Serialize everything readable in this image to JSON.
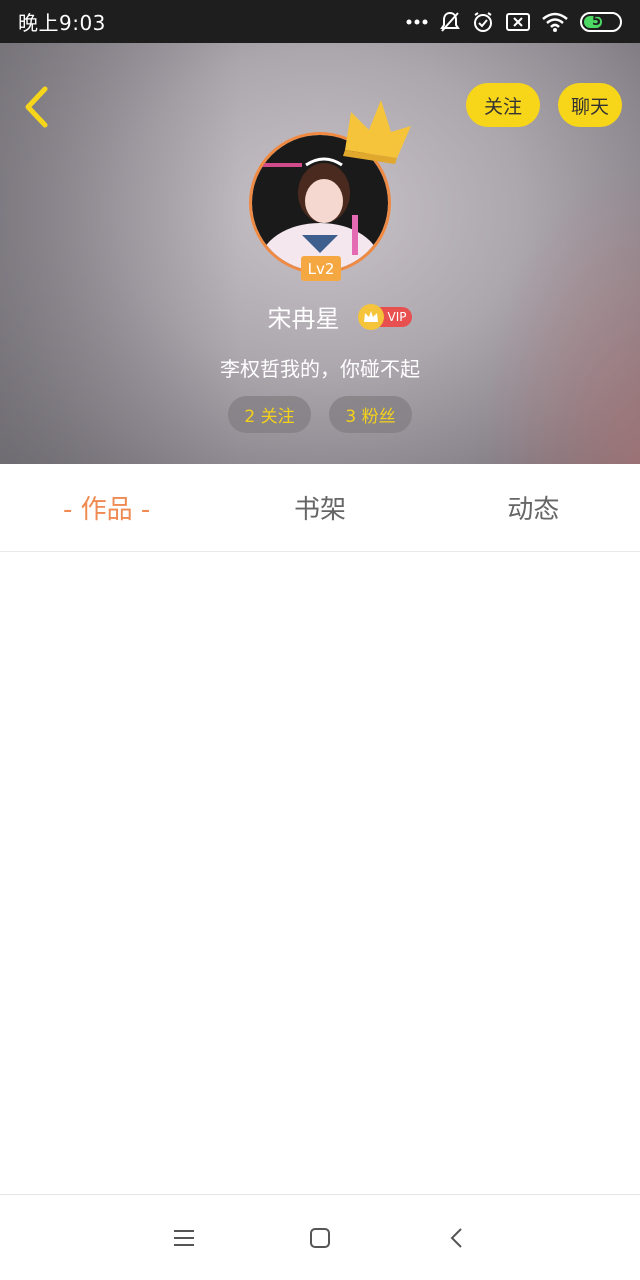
{
  "status_bar": {
    "time": "晚上9:03",
    "battery": "52",
    "battery_level": 0.52,
    "icons": [
      "more-dots-icon",
      "bell-muted-icon",
      "alarm-icon",
      "no-sim-icon",
      "wifi-icon",
      "battery-icon"
    ]
  },
  "header": {
    "follow_label": "关注",
    "chat_label": "聊天",
    "level": "Lv2",
    "user_name": "宋冉星",
    "vip_label": "VIP",
    "bio": "李权哲我的，你碰不起",
    "following": "2 关注",
    "fans": "3 粉丝"
  },
  "tabs": [
    {
      "label": "- 作品 -",
      "active": true
    },
    {
      "label": "书架",
      "active": false
    },
    {
      "label": "动态",
      "active": false
    }
  ],
  "colors": {
    "accent_yellow": "#f7d61a",
    "accent_orange": "#ef8a52",
    "vip_red": "#e8504f",
    "status_bar": "#1e1e1e"
  }
}
